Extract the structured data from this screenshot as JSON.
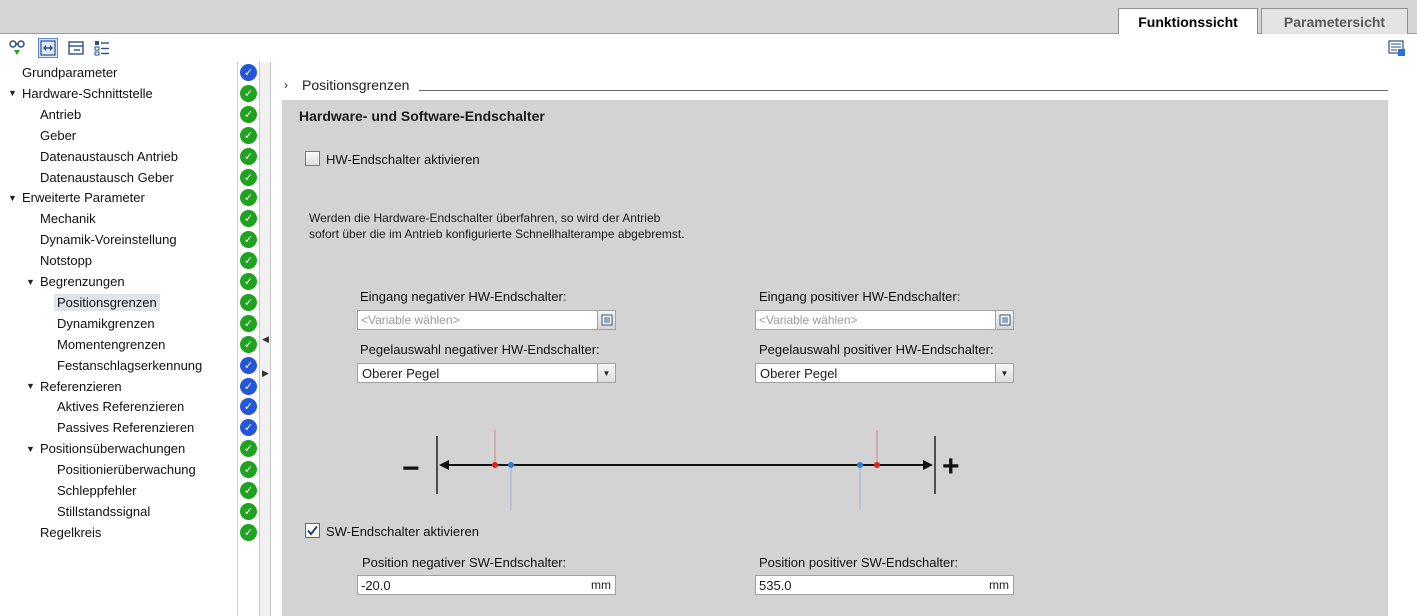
{
  "tabs": {
    "active": "Funktionssicht",
    "inactive": "Parametersicht"
  },
  "tree": [
    {
      "label": "Grundparameter",
      "status": "blue"
    },
    {
      "label": "Hardware-Schnittstelle",
      "status": "green"
    },
    {
      "label": "Antrieb",
      "status": "green"
    },
    {
      "label": "Geber",
      "status": "green"
    },
    {
      "label": "Datenaustausch Antrieb",
      "status": "green"
    },
    {
      "label": "Datenaustausch Geber",
      "status": "green"
    },
    {
      "label": "Erweiterte Parameter",
      "status": "green"
    },
    {
      "label": "Mechanik",
      "status": "green"
    },
    {
      "label": "Dynamik-Voreinstellung",
      "status": "green"
    },
    {
      "label": "Notstopp",
      "status": "green"
    },
    {
      "label": "Begrenzungen",
      "status": "green"
    },
    {
      "label": "Positionsgrenzen",
      "status": "green"
    },
    {
      "label": "Dynamikgrenzen",
      "status": "green"
    },
    {
      "label": "Momentengrenzen",
      "status": "green"
    },
    {
      "label": "Festanschlagserkennung",
      "status": "blue"
    },
    {
      "label": "Referenzieren",
      "status": "blue"
    },
    {
      "label": "Aktives Referenzieren",
      "status": "blue"
    },
    {
      "label": "Passives Referenzieren",
      "status": "blue"
    },
    {
      "label": "Positionsüberwachungen",
      "status": "green"
    },
    {
      "label": "Positionierüberwachung",
      "status": "green"
    },
    {
      "label": "Schleppfehler",
      "status": "green"
    },
    {
      "label": "Stillstandssignal",
      "status": "green"
    },
    {
      "label": "Regelkreis",
      "status": "green"
    }
  ],
  "section": {
    "title": "Positionsgrenzen"
  },
  "panel": {
    "title": "Hardware- und Software-Endschalter",
    "hw_checkbox_label": "HW-Endschalter aktivieren",
    "hw_checked": false,
    "description_line1": "Werden die Hardware-Endschalter überfahren, so wird der Antrieb",
    "description_line2": "sofort über die im Antrieb konfigurierte Schnellhalterampe abgebremst.",
    "neg_input_label": "Eingang negativer HW-Endschalter:",
    "pos_input_label": "Eingang positiver HW-Endschalter:",
    "input_placeholder": "<Variable wählen>",
    "neg_level_label": "Pegelauswahl negativer HW-Endschalter:",
    "pos_level_label": "Pegelauswahl positiver HW-Endschalter:",
    "neg_level_value": "Oberer Pegel",
    "pos_level_value": "Oberer Pegel",
    "minus_sign": "−",
    "plus_sign": "+",
    "sw_checkbox_label": "SW-Endschalter aktivieren",
    "sw_checked": true,
    "neg_sw_label": "Position negativer SW-Endschalter:",
    "pos_sw_label": "Position positiver SW-Endschalter:",
    "neg_sw_value": "-20.0",
    "pos_sw_value": "535.0",
    "unit": "mm"
  },
  "colors": {
    "status_green": "#1fa21f",
    "status_blue": "#2456d8",
    "hw_marker": "#e02020",
    "sw_marker": "#2a7fd0"
  }
}
